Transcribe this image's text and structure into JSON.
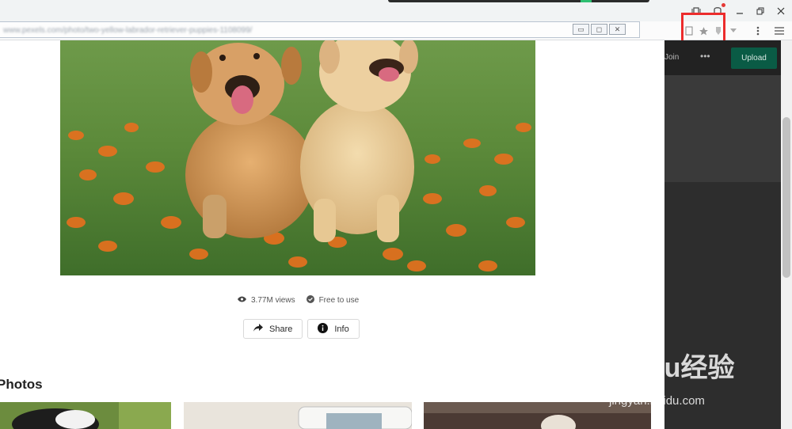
{
  "browser": {
    "url": "www.pexels.com/photo/two-yellow-labrador-retriever-puppies-1108099/",
    "highlight_color": "#ec2c2c"
  },
  "photo": {
    "views": "3.77M views",
    "license": "Free to use",
    "share_label": "Share",
    "info_label": "Info"
  },
  "related": {
    "title": "Photos"
  },
  "header_dark": {
    "join_label": "Join",
    "more_label": "•••",
    "upload_label": "Upload"
  },
  "watermark": {
    "brand": "Baidu经验",
    "site": "jingyan.baidu.com"
  },
  "icons": [
    "eye-icon",
    "check-circle-icon",
    "share-arrow-icon",
    "info-icon",
    "star-icon"
  ]
}
